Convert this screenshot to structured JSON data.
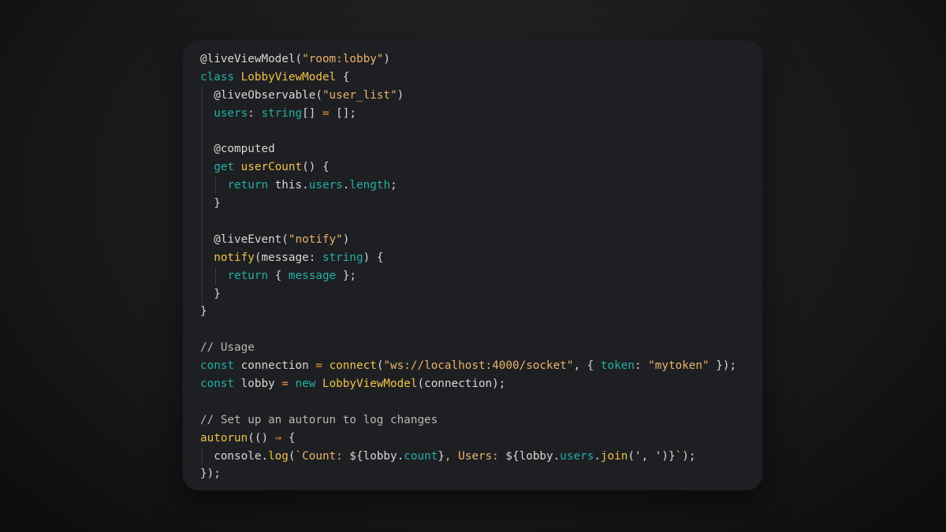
{
  "lines": [
    [
      {
        "text": "@liveViewModel(",
        "k": "dec"
      },
      {
        "text": "\"room:lobby\"",
        "k": "str"
      },
      {
        "text": ")",
        "k": "plain"
      }
    ],
    [
      {
        "text": "class ",
        "k": "kw"
      },
      {
        "text": "LobbyViewModel",
        "k": "fn"
      },
      {
        "text": " {",
        "k": "plain"
      }
    ],
    [
      {
        "text": "  @liveObservable(",
        "k": "dec"
      },
      {
        "text": "\"user_list\"",
        "k": "str"
      },
      {
        "text": ")",
        "k": "plain"
      }
    ],
    [
      {
        "text": "  ",
        "k": "plain"
      },
      {
        "text": "users",
        "k": "prop"
      },
      {
        "text": ": ",
        "k": "plain"
      },
      {
        "text": "string",
        "k": "type"
      },
      {
        "text": "[] ",
        "k": "plain"
      },
      {
        "text": "=",
        "k": "op"
      },
      {
        "text": " [];",
        "k": "plain"
      }
    ],
    [],
    [
      {
        "text": "  @computed",
        "k": "dec"
      }
    ],
    [
      {
        "text": "  ",
        "k": "plain"
      },
      {
        "text": "get ",
        "k": "kw"
      },
      {
        "text": "userCount",
        "k": "fn"
      },
      {
        "text": "() {",
        "k": "plain"
      }
    ],
    [
      {
        "text": "    ",
        "k": "plain"
      },
      {
        "text": "return ",
        "k": "kw"
      },
      {
        "text": "this.",
        "k": "plain"
      },
      {
        "text": "users",
        "k": "prop"
      },
      {
        "text": ".",
        "k": "plain"
      },
      {
        "text": "length",
        "k": "prop"
      },
      {
        "text": ";",
        "k": "plain"
      }
    ],
    [
      {
        "text": "  }",
        "k": "plain"
      }
    ],
    [],
    [
      {
        "text": "  @liveEvent(",
        "k": "dec"
      },
      {
        "text": "\"notify\"",
        "k": "str"
      },
      {
        "text": ")",
        "k": "plain"
      }
    ],
    [
      {
        "text": "  ",
        "k": "plain"
      },
      {
        "text": "notify",
        "k": "fn"
      },
      {
        "text": "(message: ",
        "k": "plain"
      },
      {
        "text": "string",
        "k": "type"
      },
      {
        "text": ") {",
        "k": "plain"
      }
    ],
    [
      {
        "text": "    ",
        "k": "plain"
      },
      {
        "text": "return ",
        "k": "kw"
      },
      {
        "text": "{ ",
        "k": "plain"
      },
      {
        "text": "message",
        "k": "prop"
      },
      {
        "text": " };",
        "k": "plain"
      }
    ],
    [
      {
        "text": "  }",
        "k": "plain"
      }
    ],
    [
      {
        "text": "}",
        "k": "plain"
      }
    ],
    [],
    [
      {
        "text": "// Usage",
        "k": "cmt"
      }
    ],
    [
      {
        "text": "const ",
        "k": "kw"
      },
      {
        "text": "connection ",
        "k": "plain"
      },
      {
        "text": "=",
        "k": "op"
      },
      {
        "text": " ",
        "k": "plain"
      },
      {
        "text": "connect",
        "k": "fn"
      },
      {
        "text": "(",
        "k": "plain"
      },
      {
        "text": "\"ws://localhost:4000/socket\"",
        "k": "str"
      },
      {
        "text": ", { ",
        "k": "plain"
      },
      {
        "text": "token",
        "k": "prop"
      },
      {
        "text": ": ",
        "k": "plain"
      },
      {
        "text": "\"mytoken\"",
        "k": "str"
      },
      {
        "text": " });",
        "k": "plain"
      }
    ],
    [
      {
        "text": "const ",
        "k": "kw"
      },
      {
        "text": "lobby ",
        "k": "plain"
      },
      {
        "text": "=",
        "k": "op"
      },
      {
        "text": " ",
        "k": "plain"
      },
      {
        "text": "new ",
        "k": "kw"
      },
      {
        "text": "LobbyViewModel",
        "k": "fn"
      },
      {
        "text": "(connection);",
        "k": "plain"
      }
    ],
    [],
    [
      {
        "text": "// Set up an autorun to log changes",
        "k": "cmt"
      }
    ],
    [
      {
        "text": "autorun",
        "k": "fn"
      },
      {
        "text": "(() ",
        "k": "plain"
      },
      {
        "text": "⇒",
        "k": "op"
      },
      {
        "text": " {",
        "k": "plain"
      }
    ],
    [
      {
        "text": "  console.",
        "k": "plain"
      },
      {
        "text": "log",
        "k": "fn"
      },
      {
        "text": "(",
        "k": "plain"
      },
      {
        "text": "`Count: ",
        "k": "str"
      },
      {
        "text": "${lobby.",
        "k": "plain"
      },
      {
        "text": "count",
        "k": "prop"
      },
      {
        "text": "}",
        "k": "plain"
      },
      {
        "text": ", Users: ",
        "k": "str"
      },
      {
        "text": "${lobby.",
        "k": "plain"
      },
      {
        "text": "users",
        "k": "prop"
      },
      {
        "text": ".",
        "k": "plain"
      },
      {
        "text": "join",
        "k": "fn"
      },
      {
        "text": "(', ')}",
        "k": "plain"
      },
      {
        "text": "`",
        "k": "str"
      },
      {
        "text": ");",
        "k": "plain"
      }
    ],
    [
      {
        "text": "});",
        "k": "plain"
      }
    ]
  ],
  "colors": {
    "background": "#1e1f23",
    "keyword": "#23b0a4",
    "function": "#f0c24a",
    "string": "#e9b36a",
    "operator": "#f0943a",
    "comment": "#b7b8b3",
    "text": "#d7d7d2"
  }
}
